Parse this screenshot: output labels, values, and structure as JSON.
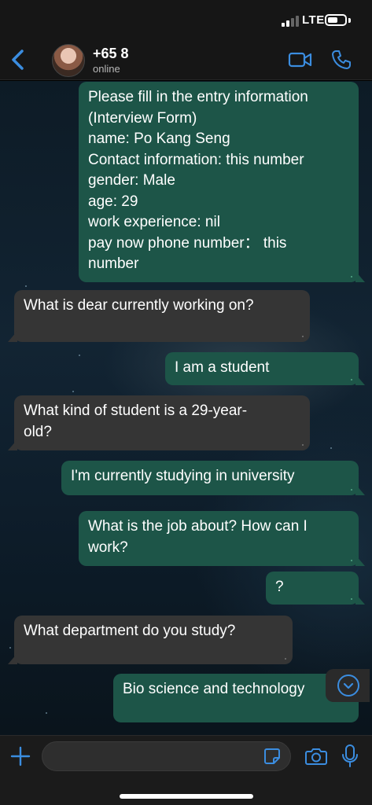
{
  "status_bar": {
    "network": "LTE",
    "signal_bars": 2,
    "signal_total": 4
  },
  "header": {
    "contact_name": "+65 8",
    "contact_status": "online"
  },
  "messages": [
    {
      "dir": "out",
      "text": "Please fill in the entry information\n(Interview Form)\nname: Po Kang Seng\nContact information: this number\ngender: Male\nage: 29\nwork experience: nil\npay now phone number：  this\nnumber"
    },
    {
      "dir": "in",
      "text": "What is dear currently working on?"
    },
    {
      "dir": "out",
      "text": "I am a student"
    },
    {
      "dir": "in",
      "text": "What kind of student is a 29-year-\nold?"
    },
    {
      "dir": "out",
      "text": "I'm currently studying in university"
    },
    {
      "dir": "out",
      "text": "What is the job about? How can I\nwork?"
    },
    {
      "dir": "out",
      "text": "?"
    },
    {
      "dir": "in",
      "text": "What department do you study?"
    },
    {
      "dir": "out",
      "text": "Bio science and technology"
    }
  ],
  "input": {
    "value": "",
    "placeholder": ""
  },
  "colors": {
    "accent": "#3b8de0",
    "outgoing_bubble": "#1d5548",
    "incoming_bubble": "#353535"
  },
  "icons": [
    "back-chevron-icon",
    "video-call-icon",
    "phone-call-icon",
    "scroll-down-icon",
    "plus-icon",
    "sticker-icon",
    "camera-icon",
    "microphone-icon"
  ]
}
